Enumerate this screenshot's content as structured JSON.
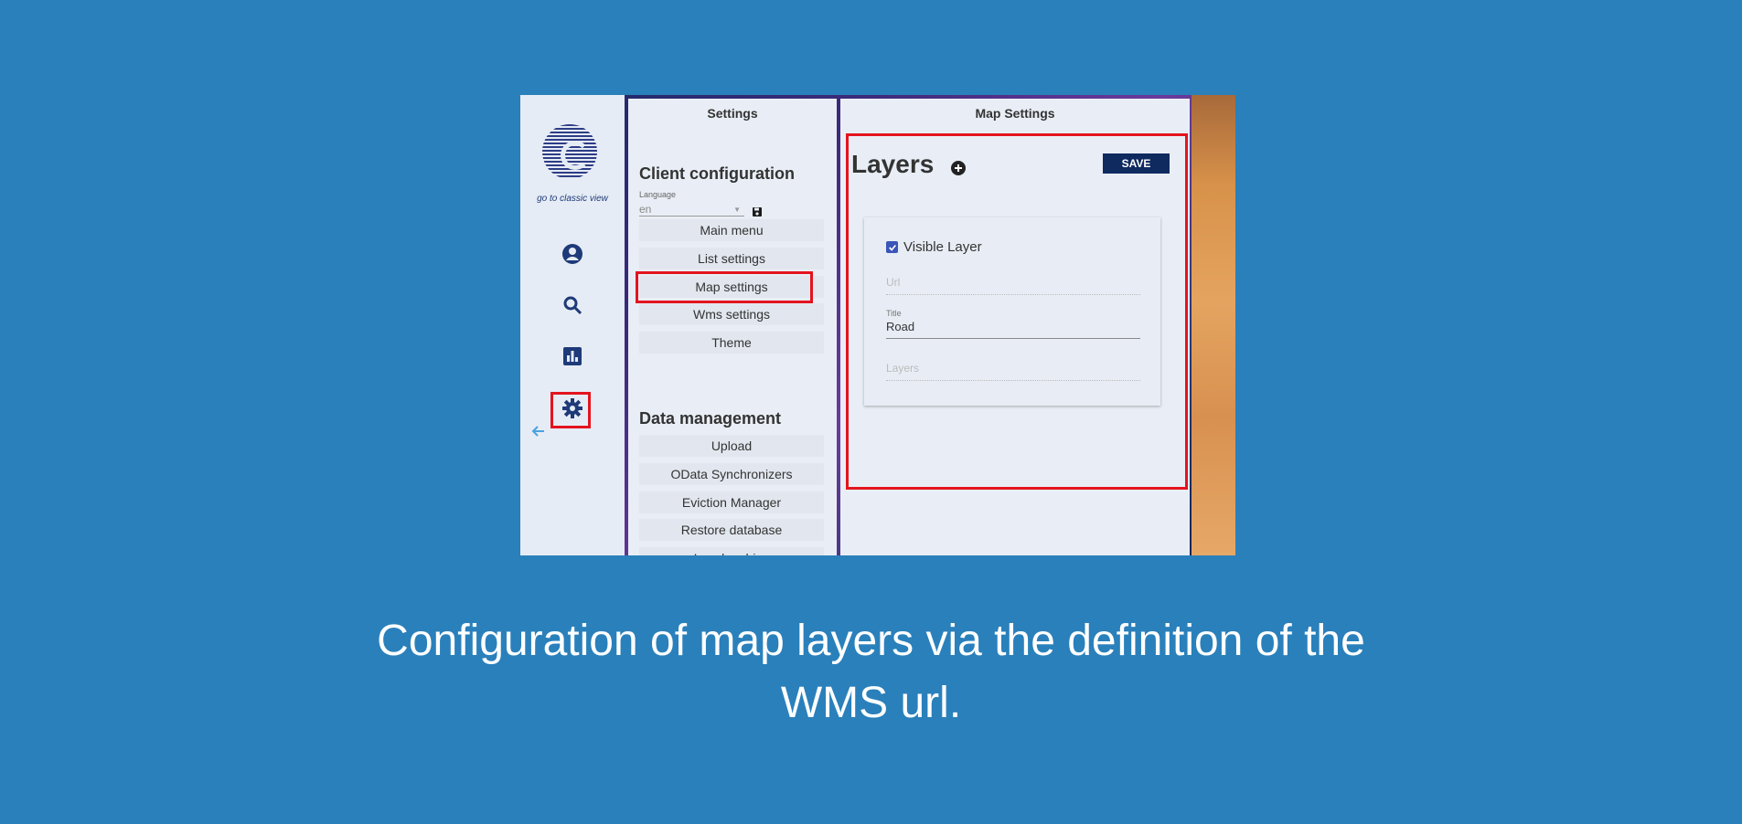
{
  "leftbar": {
    "classic_link": "go to classic view",
    "icons": [
      "account-icon",
      "search-icon",
      "chart-icon",
      "gear-icon",
      "back-arrow-icon"
    ]
  },
  "settings": {
    "title": "Settings",
    "client_config_heading": "Client configuration",
    "language_label": "Language",
    "language_value": "en",
    "menu": [
      "Main menu",
      "List settings",
      "Map settings",
      "Wms settings",
      "Theme"
    ],
    "data_management_heading": "Data management",
    "data_menu": [
      "Upload",
      "OData Synchronizers",
      "Eviction Manager",
      "Restore database",
      "Local archive"
    ]
  },
  "map_settings": {
    "title": "Map Settings",
    "layers_heading": "Layers",
    "save_label": "SAVE",
    "visible_layer_label": "Visible Layer",
    "visible_layer_checked": true,
    "url_placeholder": "Url",
    "title_label": "Title",
    "title_value": "Road",
    "layers_placeholder": "Layers"
  },
  "caption": {
    "line1": "Configuration of map layers via the definition of the",
    "line2": "WMS url."
  },
  "colors": {
    "background": "#2a80bb",
    "highlight": "#e3141e",
    "save_button": "#0f2a5f",
    "icon": "#1e3a78"
  }
}
